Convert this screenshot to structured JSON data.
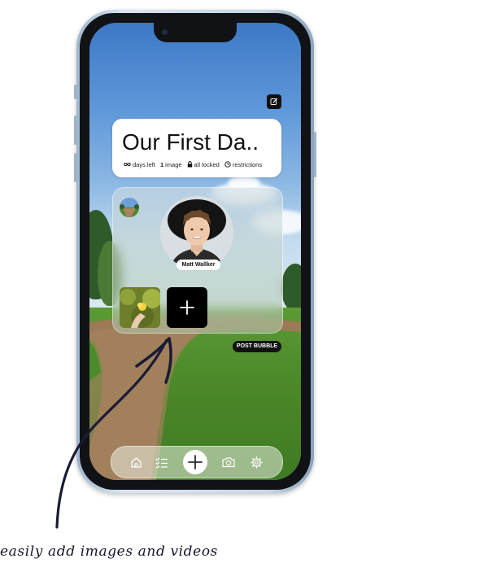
{
  "header": {
    "edit_icon": "edit-icon"
  },
  "title_card": {
    "title": "Our First Da..",
    "meta": {
      "days_left": "days left",
      "image_count": "1",
      "image_label": "image",
      "lock_label": "all locked",
      "restrictions_label": "restrictions"
    }
  },
  "bubble": {
    "name": "Matt Wallker"
  },
  "post_bubble_label": "POST BUBBLE",
  "tabbar": {
    "items": [
      "home-icon",
      "checklist-icon",
      "plus-icon",
      "camera-icon",
      "settings-icon"
    ]
  },
  "annotation": {
    "caption": "easily add images and videos"
  },
  "colors": {
    "ink": "#14152a",
    "card": "#ffffff",
    "button": "#111111"
  }
}
